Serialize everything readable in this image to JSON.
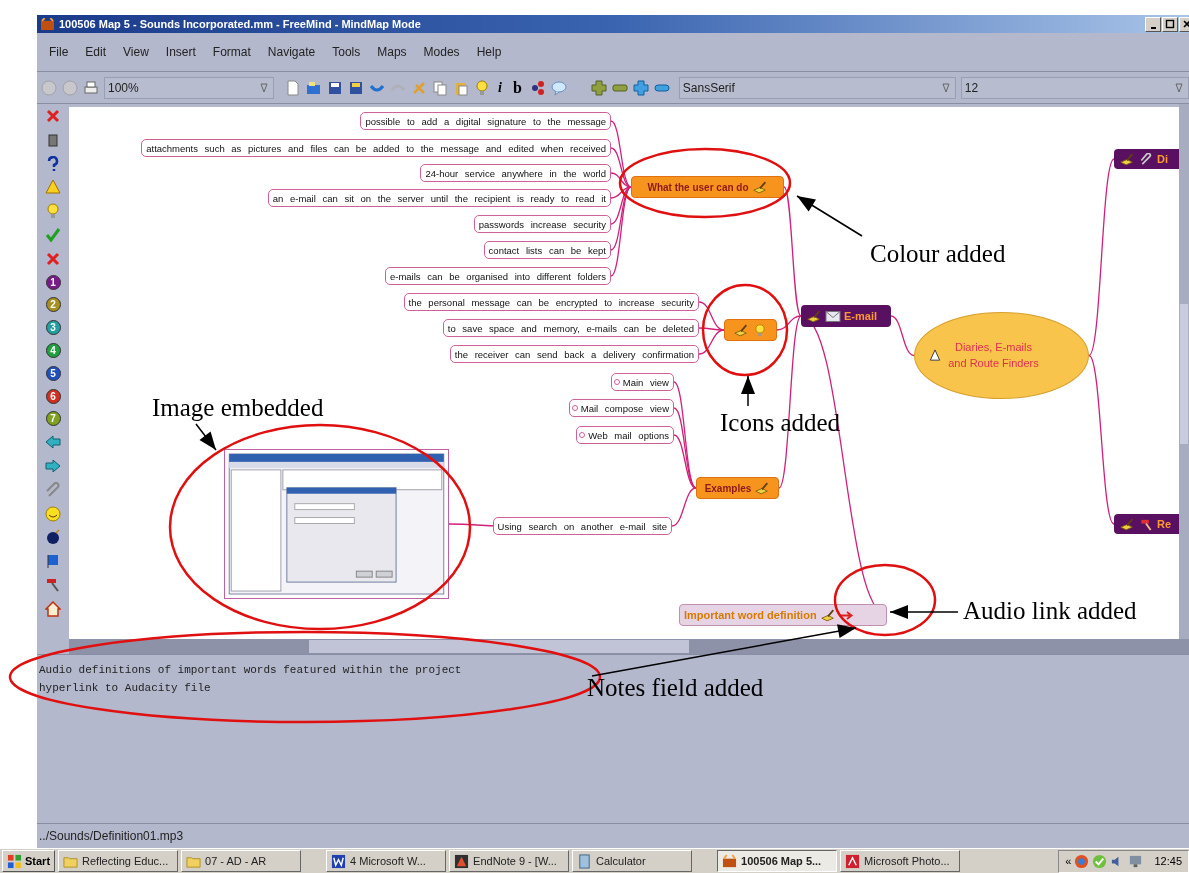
{
  "window": {
    "title": "100506 Map 5 - Sounds Incorporated.mm - FreeMind - MindMap Mode"
  },
  "menu": [
    {
      "label": "File"
    },
    {
      "label": "Edit"
    },
    {
      "label": "View"
    },
    {
      "label": "Insert"
    },
    {
      "label": "Format"
    },
    {
      "label": "Navigate"
    },
    {
      "label": "Tools"
    },
    {
      "label": "Maps"
    },
    {
      "label": "Modes"
    },
    {
      "label": "Help"
    }
  ],
  "toolbar": {
    "zoom": "100%",
    "italic": "i",
    "bold": "b",
    "font": "SansSerif",
    "size": "12"
  },
  "icon_bar": {
    "priorities": [
      "1",
      "2",
      "3",
      "4",
      "5",
      "6",
      "7"
    ]
  },
  "map": {
    "text": "Diaries, E-mails and Route Finders",
    "kind": "root",
    "children": [
      {
        "text": "Di",
        "kind": "branch"
      },
      {
        "text": "E-mail",
        "kind": "branch",
        "children": [
          {
            "text": "What the user can do",
            "kind": "topic",
            "children": [
              {
                "text": "possible to add a digital signature to the message",
                "kind": "leaf"
              },
              {
                "text": "attachments such as pictures and files can be added to the message and edited when received",
                "kind": "leaf"
              },
              {
                "text": "24-hour service anywhere in the world",
                "kind": "leaf"
              },
              {
                "text": "an e-mail can sit on the server until the recipient is ready to read it",
                "kind": "leaf"
              },
              {
                "text": "passwords increase security",
                "kind": "leaf"
              },
              {
                "text": "contact lists can be kept",
                "kind": "leaf"
              },
              {
                "text": "e-mails can be organised into different folders",
                "kind": "leaf"
              }
            ]
          },
          {
            "kind": "topic",
            "children": [
              {
                "text": "the personal message can be encrypted to increase security",
                "kind": "leaf"
              },
              {
                "text": "to save space and memory, e-mails can be deleted",
                "kind": "leaf"
              },
              {
                "text": "the receiver can send back a delivery confirmation",
                "kind": "leaf"
              }
            ]
          },
          {
            "text": "Examples",
            "kind": "topic",
            "children": [
              {
                "text": "Main view",
                "kind": "leaf",
                "folded": true
              },
              {
                "text": "Mail compose view",
                "kind": "leaf",
                "folded": true
              },
              {
                "text": "Web mail options",
                "kind": "leaf",
                "folded": true
              },
              {
                "text": "Using search on another e-mail site",
                "kind": "leaf",
                "children": [
                  {
                    "kind": "image"
                  }
                ]
              }
            ]
          },
          {
            "text": "Important word definition",
            "kind": "link"
          }
        ]
      },
      {
        "text": "Re",
        "kind": "branch"
      }
    ]
  },
  "annotations": [
    {
      "text": "Colour added"
    },
    {
      "text": "Image embedded"
    },
    {
      "text": "Icons added"
    },
    {
      "text": "Audio link added"
    },
    {
      "text": "Notes field added"
    }
  ],
  "notes": [
    "Audio definitions of important words featured within the project",
    "hyperlink to Audacity file"
  ],
  "status_bar": "../Sounds/Definition01.mp3",
  "taskbar": {
    "start": "Start",
    "items": [
      {
        "label": "Reflecting Educ...",
        "selected": false
      },
      {
        "label": "07 - AD - AR",
        "selected": false
      },
      {
        "label": "4 Microsoft W...",
        "selected": false
      },
      {
        "label": "EndNote 9 - [W...",
        "selected": false
      },
      {
        "label": "Calculator",
        "selected": false
      },
      {
        "label": "100506 Map 5...",
        "selected": true
      },
      {
        "label": "Microsoft Photo...",
        "selected": false
      }
    ],
    "tray_toggle": "«",
    "clock": "12:45"
  }
}
